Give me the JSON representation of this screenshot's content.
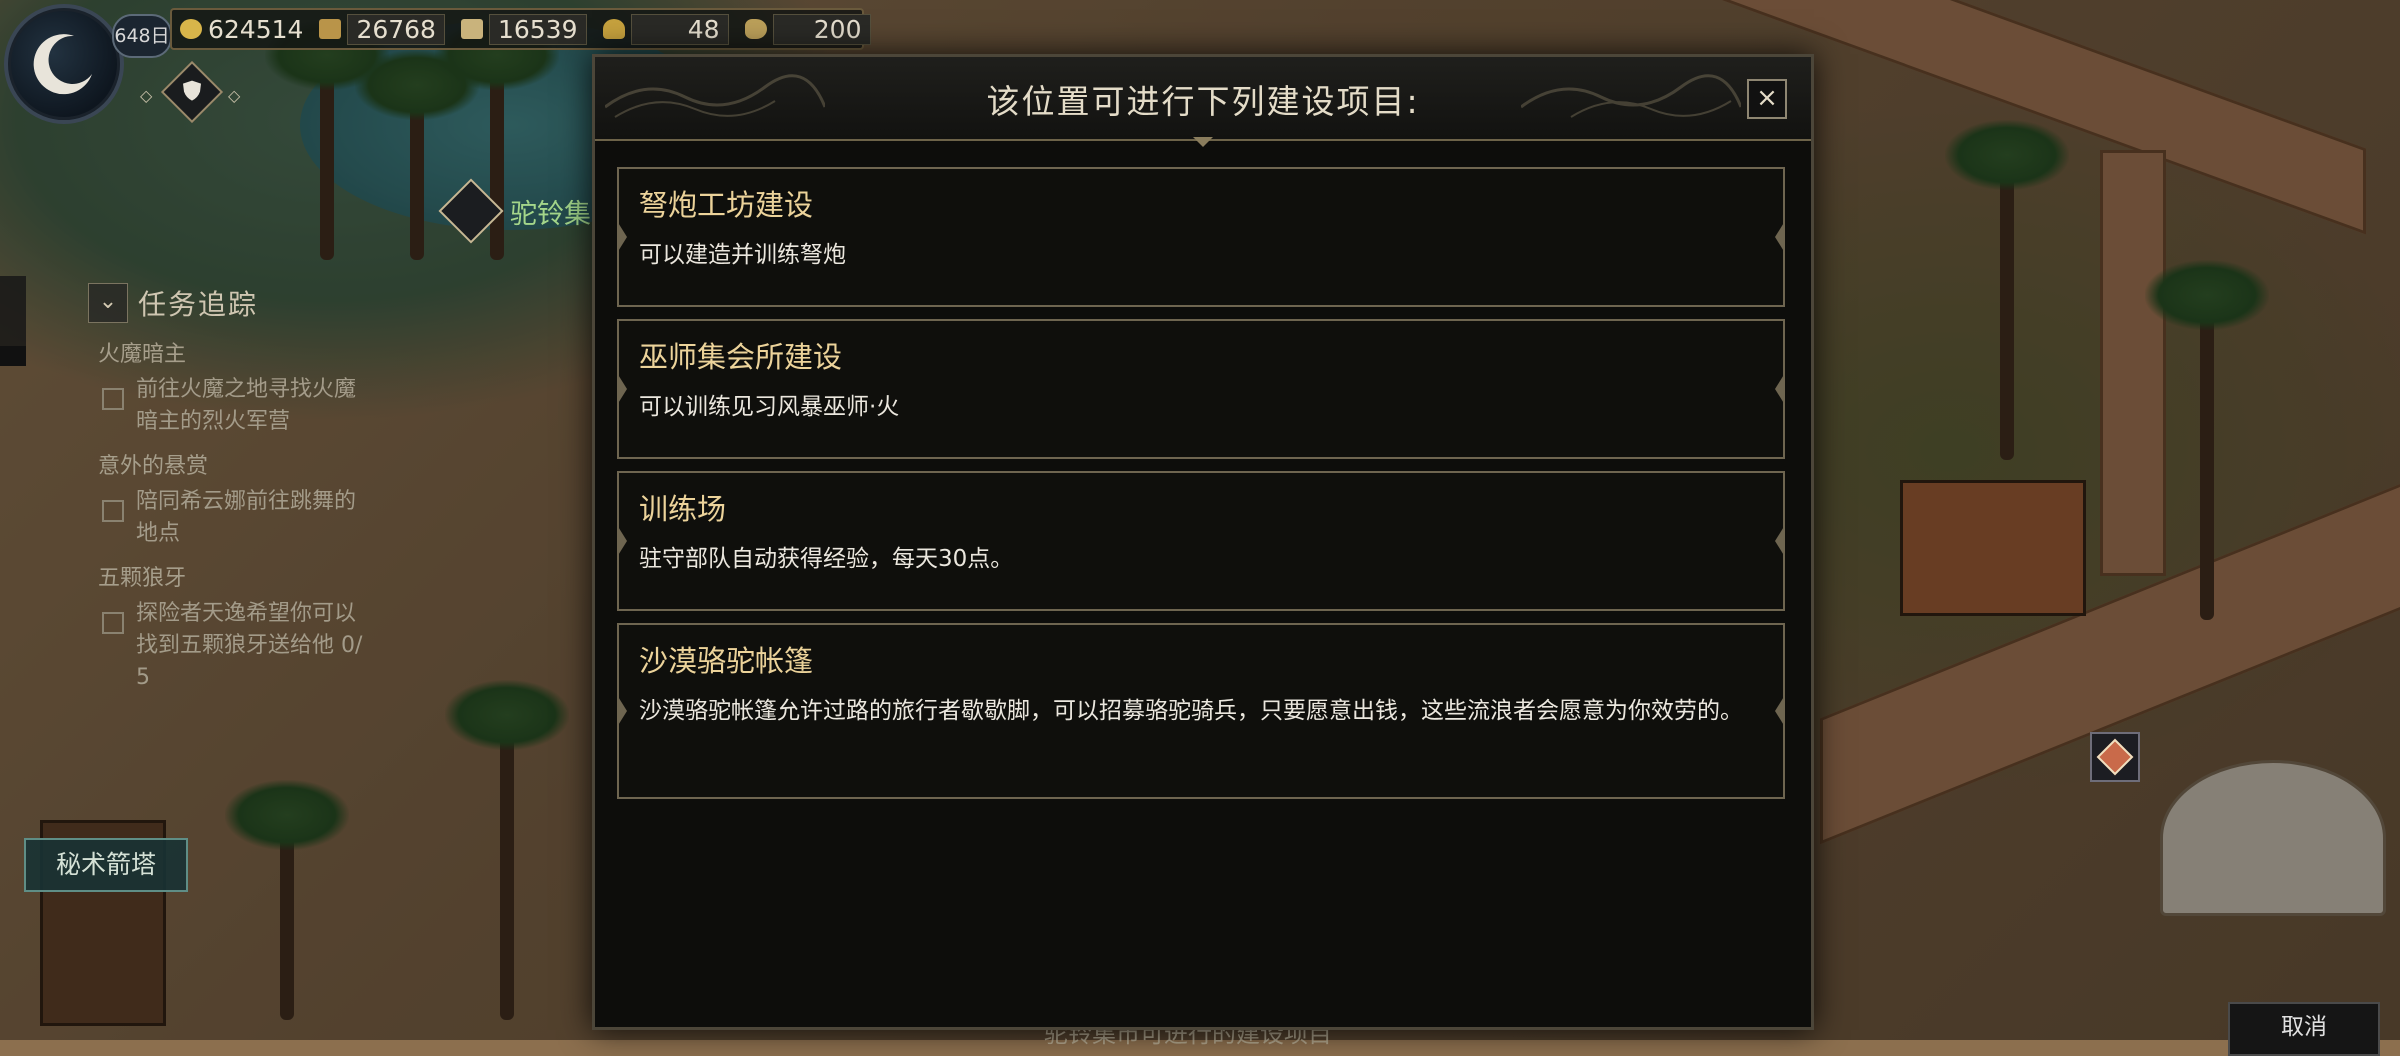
{
  "hud": {
    "day": "648日",
    "resources": [
      {
        "name": "gold",
        "icon": "gold-coin-icon",
        "value": "624514"
      },
      {
        "name": "lumber",
        "icon": "lumber-icon",
        "value": "26768"
      },
      {
        "name": "stone",
        "icon": "stone-icon",
        "value": "16539"
      },
      {
        "name": "food",
        "icon": "grain-icon",
        "value": "48"
      },
      {
        "name": "population",
        "icon": "horn-icon",
        "value": "200"
      }
    ]
  },
  "location": {
    "label": "驼铃集"
  },
  "quest_tracker": {
    "title": "任务追踪",
    "quests": [
      {
        "category": "火魔暗主",
        "lines": [
          "前往火魔之地寻找火魔",
          "暗主的烈火军营"
        ]
      },
      {
        "category": "意外的悬赏",
        "lines": [
          "陪同希云娜前往跳舞的",
          "地点"
        ]
      },
      {
        "category": "五颗狼牙",
        "lines": [
          "探险者天逸希望你可以",
          "找到五颗狼牙送给他  0/",
          "5"
        ]
      }
    ]
  },
  "map_labels": {
    "arcane_tower": "秘术箭塔"
  },
  "dialog": {
    "title": "该位置可进行下列建设项目:",
    "close_label": "×",
    "items": [
      {
        "name": "弩炮工坊建设",
        "desc": "可以建造并训练弩炮"
      },
      {
        "name": "巫师集会所建设",
        "desc": "可以训练见习风暴巫师·火"
      },
      {
        "name": "训练场",
        "desc": "驻守部队自动获得经验，每天30点。"
      },
      {
        "name": "沙漠骆驼帐篷",
        "desc": "沙漠骆驼帐篷允许过路的旅行者歇歇脚，可以招募骆驼骑兵，只要愿意出钱，这些流浪者会愿意为你效劳的。"
      }
    ]
  },
  "bottom": {
    "ghost_text": "驼铃集市可进行的建设项目",
    "cancel_label": "取消"
  },
  "colors": {
    "dialog_bg": "#0d0d0b",
    "item_title": "#ecd39a",
    "item_border": "#6e6550",
    "location_label": "#a4d68a"
  }
}
